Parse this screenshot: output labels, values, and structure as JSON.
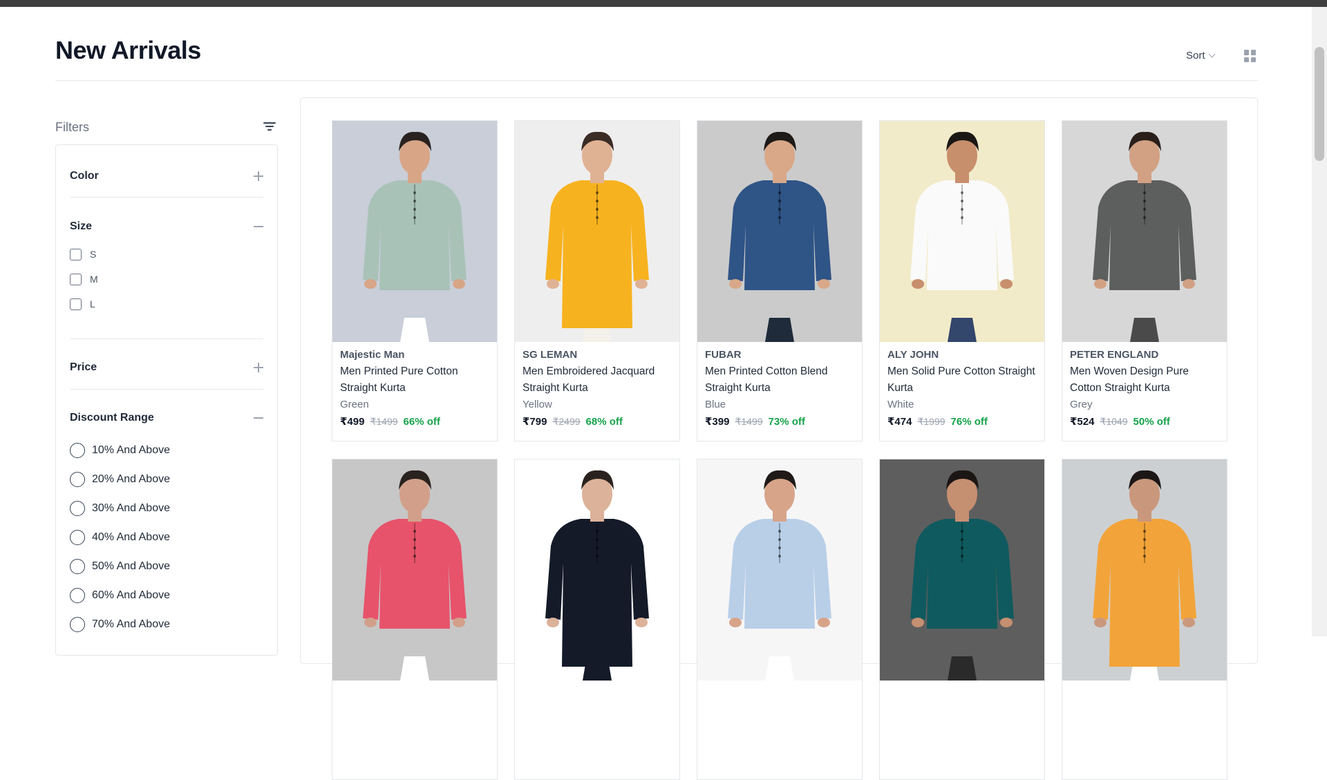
{
  "header": {
    "title": "New Arrivals",
    "sort_label": "Sort"
  },
  "filters": {
    "title": "Filters",
    "sections": [
      {
        "label": "Color",
        "expanded": false
      },
      {
        "label": "Size",
        "expanded": true,
        "options": [
          "S",
          "M",
          "L"
        ]
      },
      {
        "label": "Price",
        "expanded": false
      },
      {
        "label": "Discount Range",
        "expanded": true,
        "options": [
          "10% And Above",
          "20% And Above",
          "30% And Above",
          "40% And Above",
          "50% And Above",
          "60% And Above",
          "70% And Above"
        ]
      }
    ]
  },
  "products": [
    {
      "brand": "Majestic Man",
      "name": "Men Printed Pure Cotton Straight Kurta",
      "color": "Green",
      "price": "₹499",
      "mrp": "₹1499",
      "discount": "66% off",
      "bg": "#c9ced8",
      "garment": "#a9c2b8",
      "bottom": "#ffffff",
      "skin": "#d8a587",
      "hair": "#2a2220",
      "long": false
    },
    {
      "brand": "SG LEMAN",
      "name": "Men Embroidered Jacquard Straight Kurta",
      "color": "Yellow",
      "price": "₹799",
      "mrp": "₹2499",
      "discount": "68% off",
      "bg": "#eeeeee",
      "garment": "#f7b21f",
      "bottom": "#f3f1ea",
      "skin": "#e0b294",
      "hair": "#3b2c25",
      "long": true
    },
    {
      "brand": "FUBAR",
      "name": "Men Printed Cotton Blend Straight Kurta",
      "color": "Blue",
      "price": "₹399",
      "mrp": "₹1499",
      "discount": "73% off",
      "bg": "#cbcbcb",
      "garment": "#2f5486",
      "bottom": "#1f2b3a",
      "skin": "#d9a888",
      "hair": "#1e1a18",
      "long": false
    },
    {
      "brand": "ALY JOHN",
      "name": "Men Solid Pure Cotton Straight Kurta",
      "color": "White",
      "price": "₹474",
      "mrp": "₹1999",
      "discount": "76% off",
      "bg": "#f1ebc9",
      "garment": "#fafafa",
      "bottom": "#33466b",
      "skin": "#c88f6c",
      "hair": "#1b1715",
      "long": false
    },
    {
      "brand": "PETER ENGLAND",
      "name": "Men Woven Design Pure Cotton Straight Kurta",
      "color": "Grey",
      "price": "₹524",
      "mrp": "₹1049",
      "discount": "50% off",
      "bg": "#d7d7d7",
      "garment": "#5d5e5e",
      "bottom": "#4a4a4a",
      "skin": "#d2a184",
      "hair": "#2a1f1a",
      "long": false
    },
    {
      "bg": "#c7c7c7",
      "garment": "#e7536b",
      "bottom": "#ffffff",
      "skin": "#d2a08a",
      "hair": "#2a221f",
      "long": false
    },
    {
      "bg": "#ffffff",
      "garment": "#141a28",
      "bottom": "#141a28",
      "skin": "#dcb29a",
      "hair": "#2a221f",
      "long": true
    },
    {
      "bg": "#f6f6f6",
      "garment": "#b9cfe8",
      "bottom": "#ffffff",
      "skin": "#d7a48a",
      "hair": "#1f1a18",
      "long": false
    },
    {
      "bg": "#5e5e5e",
      "garment": "#0f5a5e",
      "bottom": "#2a2a2a",
      "skin": "#c58f71",
      "hair": "#1b1614",
      "long": false
    },
    {
      "bg": "#cdd0d2",
      "garment": "#f2a43a",
      "bottom": "#ffffff",
      "skin": "#c9987c",
      "hair": "#1c1716",
      "long": true
    }
  ]
}
